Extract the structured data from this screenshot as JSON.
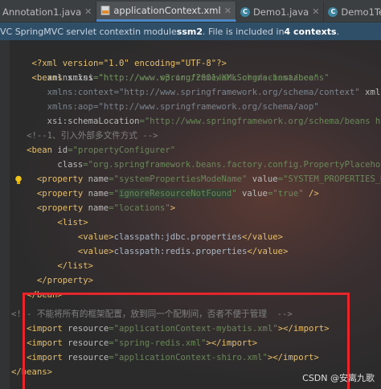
{
  "tabs": [
    {
      "label": "Annotation1.java",
      "icon": "java-class-icon",
      "active": false
    },
    {
      "label": "applicationContext.xml",
      "icon": "xml-file-icon",
      "active": true
    },
    {
      "label": "Demo1.java",
      "icon": "java-class-icon",
      "active": false
    },
    {
      "label": "Demo1Test.java",
      "icon": "java-class-icon",
      "active": false
    }
  ],
  "notice": {
    "part1": "VC SpringMVC servlet context",
    "part2": " in module ",
    "module": "ssm2",
    "part3": ". File is included in ",
    "count": "4 contexts",
    "part4": "."
  },
  "code": {
    "l1": "<?xml version=\"1.0\" encoding=\"UTF-8\"?>",
    "l2_tag": "<beans ",
    "l2_attr": "xmlns",
    "l2_val": "=\"http://www.springframework.org/schema/beans\"",
    "l3_attr": "xmlns:xsi",
    "l3_val": "=\"http://www.w3.org/2001/XMLSchema-instance\"",
    "l4_attr": "xmlns:context",
    "l4_val": "=\"http://www.springframework.org/schema/context\"",
    "l4_tail": " xmlns:tx=\"h",
    "l5_attr": "xmlns:aop",
    "l5_val": "=\"http://www.springframework.org/schema/aop\"",
    "l6_attr": "xsi:schemaLocation",
    "l6_val": "=\"http://www.springframework.org/schema/beans http://www",
    "l7": "<!--1、引入外部多文件方式 -->",
    "l8_tag": "<bean ",
    "l8_attr": "id",
    "l8_val": "=\"propertyConfigurer\"",
    "l9_attr": "class",
    "l9_val": "=\"org.springframework.beans.factory.config.PropertyPlaceholderConfi",
    "l10_tag": "<property ",
    "l10_attr": "name",
    "l10_val": "=\"systemPropertiesModeName\"",
    "l10_attr2": " value",
    "l10_val2": "=\"SYSTEM_PROPERTIES_MODE_O",
    "l11_tag": "<property ",
    "l11_attr": "name",
    "l11_val_pre": "=\"",
    "l11_val_hl": "ignoreResourceNotFound",
    "l11_val_post": "\"",
    "l11_attr2": " value",
    "l11_val2": "=\"true\"",
    "l11_end": " />",
    "l12_tag": "<property ",
    "l12_attr": "name",
    "l12_val": "=\"locations\"",
    "l12_end": ">",
    "l13": "<list>",
    "l14_open": "<value>",
    "l14_text": "classpath:jdbc.properties",
    "l14_close": "</value>",
    "l15_open": "<value>",
    "l15_text": "classpath:redis.properties",
    "l15_close": "</value>",
    "l16": "</list>",
    "l17": "</property>",
    "l18": "</bean>",
    "l19": "<!-- 不能将所有的框架配置，放到同一个配制间，否者不便于管理  -->",
    "l20_tag": "<import ",
    "l20_attr": "resource",
    "l20_val": "=\"applicationContext-mybatis.xml\"",
    "l20_end": "></import>",
    "l21_tag": "<import ",
    "l21_attr": "resource",
    "l21_val": "=\"spring-redis.xml\"",
    "l21_end": "></import>",
    "l22_tag": "<import ",
    "l22_attr": "resource",
    "l22_val": "=\"applicationContext-shiro.xml\"",
    "l22_end": "></import>",
    "l23": "</beans>"
  },
  "watermark": "CSDN @安离九歌",
  "colors": {
    "tag": "#e8bf6a",
    "attribute": "#bababa",
    "value": "#6a8759",
    "comment": "#808080",
    "highlight_box": "#e5262a"
  }
}
